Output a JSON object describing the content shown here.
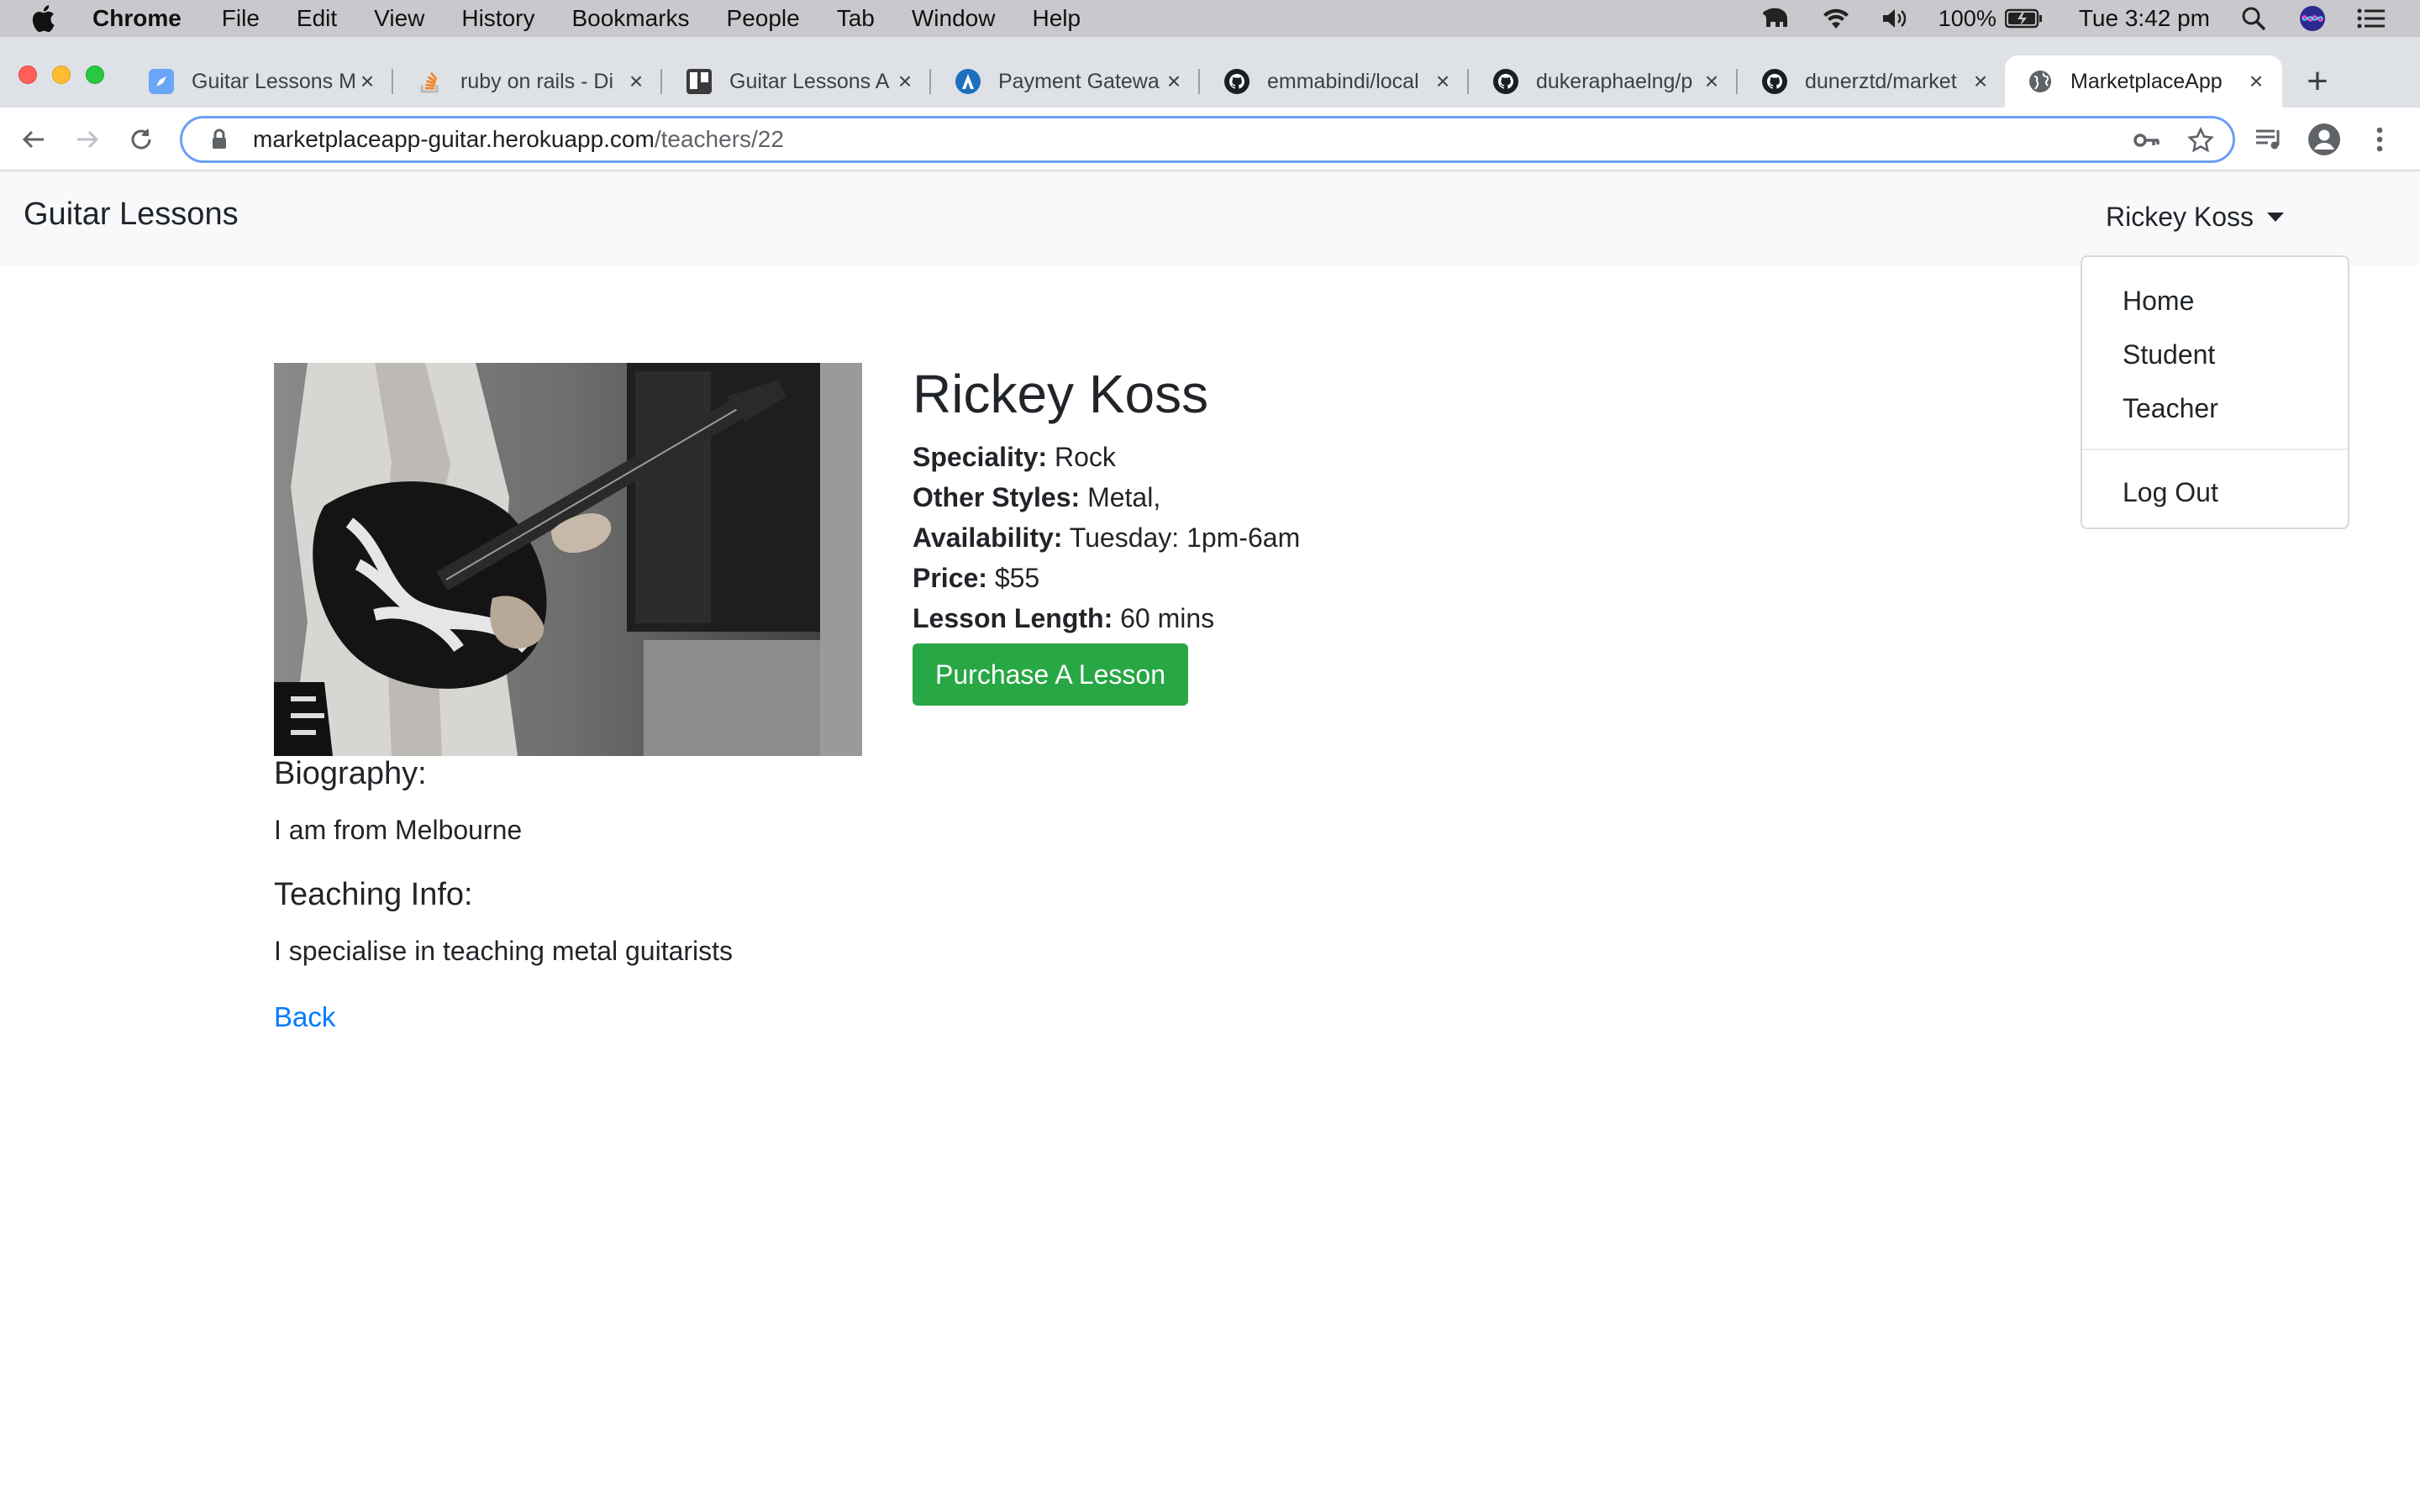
{
  "os_menubar": {
    "app_name": "Chrome",
    "menus": [
      "File",
      "Edit",
      "View",
      "History",
      "Bookmarks",
      "People",
      "Tab",
      "Window",
      "Help"
    ],
    "battery": "100%",
    "clock": "Tue 3:42 pm"
  },
  "browser": {
    "tabs": [
      {
        "title": "Guitar Lessons M",
        "icon": "compass-icon"
      },
      {
        "title": "ruby on rails - Di",
        "icon": "stackoverflow-icon"
      },
      {
        "title": "Guitar Lessons A",
        "icon": "trello-icon"
      },
      {
        "title": "Payment Gatewa",
        "icon": "a-logo-icon"
      },
      {
        "title": "emmabindi/local",
        "icon": "github-icon"
      },
      {
        "title": "dukeraphaelng/p",
        "icon": "github-icon"
      },
      {
        "title": "dunerztd/market",
        "icon": "github-icon"
      },
      {
        "title": "MarketplaceApp",
        "icon": "globe-icon",
        "active": true
      }
    ],
    "url_host": "marketplaceapp-guitar.herokuapp.com",
    "url_path": "/teachers/22"
  },
  "navbar": {
    "brand": "Guitar Lessons",
    "user_name": "Rickey Koss",
    "dropdown": [
      "Home",
      "Student",
      "Teacher",
      "Log Out"
    ]
  },
  "teacher": {
    "name": "Rickey Koss",
    "speciality_label": "Speciality:",
    "speciality": "Rock",
    "other_styles_label": "Other Styles:",
    "other_styles": "Metal,",
    "availability_label": "Availability:",
    "availability": "Tuesday: 1pm-6am",
    "price_label": "Price:",
    "price": "$55",
    "lesson_length_label": "Lesson Length:",
    "lesson_length": "60 mins",
    "purchase_button": "Purchase A Lesson",
    "biography_heading": "Biography:",
    "biography": "I am from Melbourne",
    "teaching_info_heading": "Teaching Info:",
    "teaching_info": "I specialise in teaching metal guitarists",
    "back_link": "Back"
  },
  "colors": {
    "accent": "#28a745",
    "link": "#007bff",
    "omnibox_focus": "#6a9ff7"
  }
}
